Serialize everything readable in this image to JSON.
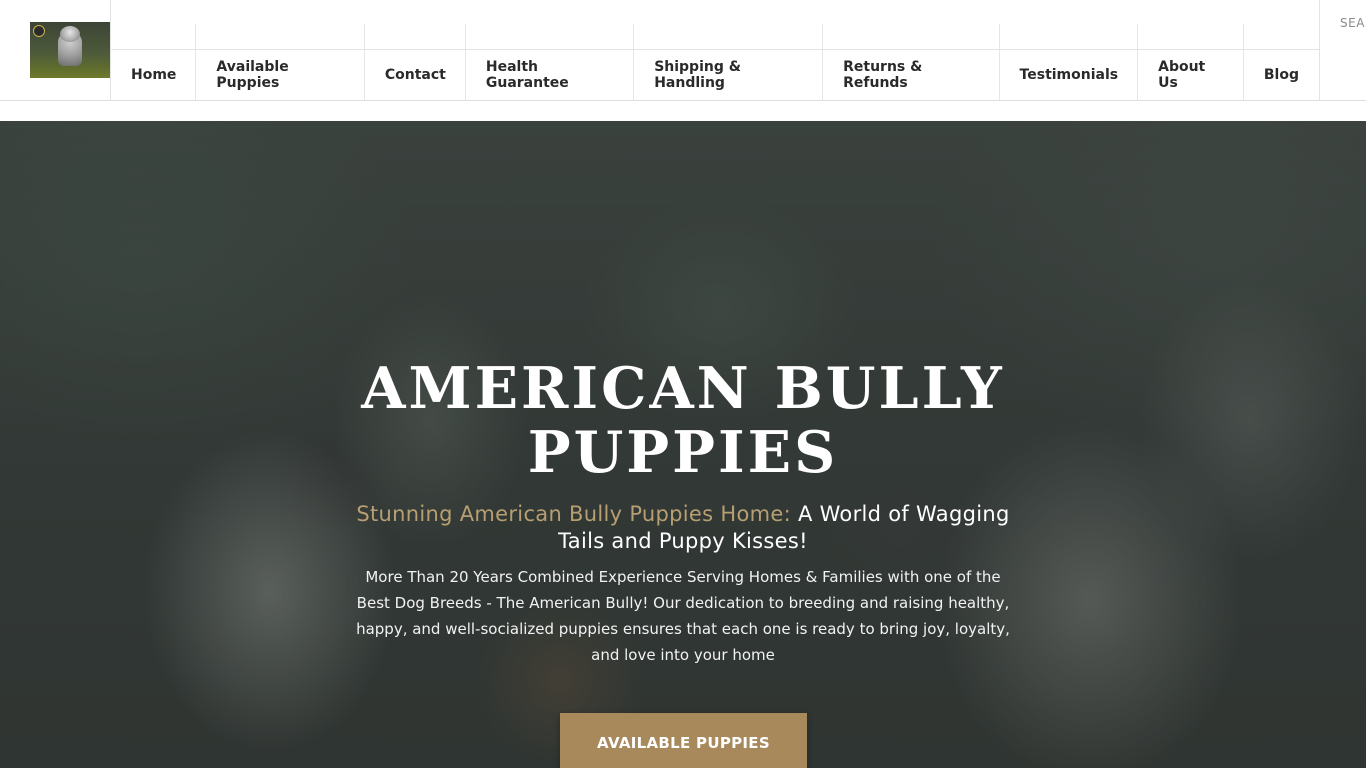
{
  "header": {
    "search_label": "SEARCH",
    "nav": [
      {
        "label": "Home"
      },
      {
        "label": "Available Puppies"
      },
      {
        "label": "Contact"
      },
      {
        "label": "Health Guarantee"
      },
      {
        "label": "Shipping & Handling"
      },
      {
        "label": "Returns & Refunds"
      },
      {
        "label": "Testimonials"
      },
      {
        "label": "About Us"
      },
      {
        "label": "Blog"
      }
    ]
  },
  "hero": {
    "title": "AMERICAN BULLY PUPPIES",
    "subtitle_accent": "Stunning American Bully Puppies Home:",
    "subtitle_rest": " A World of Wagging Tails and Puppy Kisses!",
    "description": "More Than 20 Years Combined Experience Serving Homes & Families with one of the Best Dog Breeds - The American Bully! Our dedication to breeding and raising healthy, happy, and well-socialized puppies ensures that each one is ready to bring joy, loyalty, and love into your home",
    "button_label": "AVAILABLE PUPPIES"
  },
  "colors": {
    "accent": "#b79f72",
    "button": "#a8895b",
    "nav_text": "#2a2a2a"
  }
}
